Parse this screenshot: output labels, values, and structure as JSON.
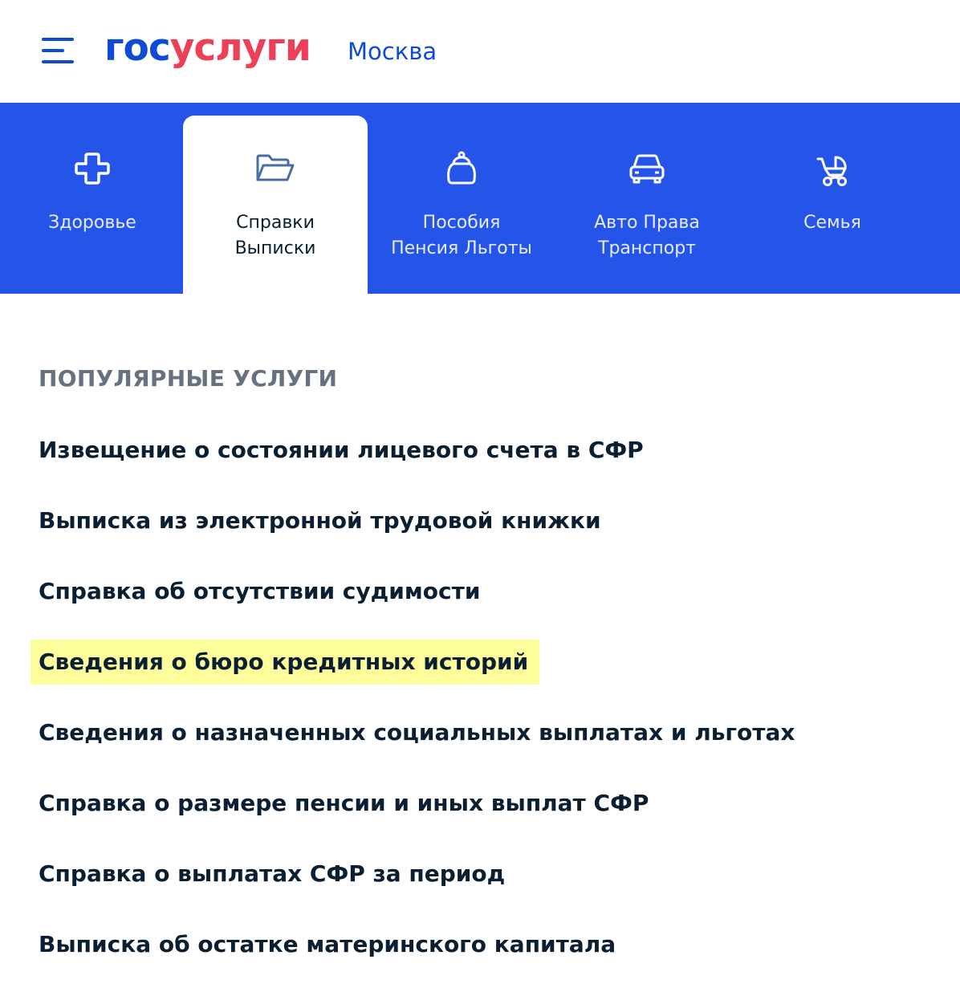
{
  "header": {
    "logo_part1": "гос",
    "logo_part2": "услуги",
    "city": "Москва",
    "menu_icon": "burger-menu-icon"
  },
  "colors": {
    "brand_blue": "#0d4cd3",
    "brand_red": "#ee3f58",
    "category_bar": "#2554e8",
    "highlight": "#fdfd9c"
  },
  "categories": [
    {
      "line1": "Здоровье",
      "line2": "",
      "icon": "medical-cross-icon",
      "active": false
    },
    {
      "line1": "Справки",
      "line2": "Выписки",
      "icon": "folder-icon",
      "active": true
    },
    {
      "line1": "Пособия",
      "line2": "Пенсия Льготы",
      "icon": "purse-icon",
      "active": false
    },
    {
      "line1": "Авто Права",
      "line2": "Транспорт",
      "icon": "car-icon",
      "active": false
    },
    {
      "line1": "Семья",
      "line2": "",
      "icon": "stroller-icon",
      "active": false
    }
  ],
  "popular": {
    "title": "ПОПУЛЯРНЫЕ УСЛУГИ",
    "items": [
      "Извещение о состоянии лицевого счета в СФР",
      "Выписка из электронной трудовой книжки",
      "Справка об отсутствии судимости",
      "Сведения о бюро кредитных историй",
      "Сведения о назначенных социальных выплатах и льготах",
      "Справка о размере пенсии и иных выплат СФР",
      "Справка о выплатах СФР за период",
      "Выписка об остатке материнского капитала"
    ],
    "highlighted_index": 3
  }
}
